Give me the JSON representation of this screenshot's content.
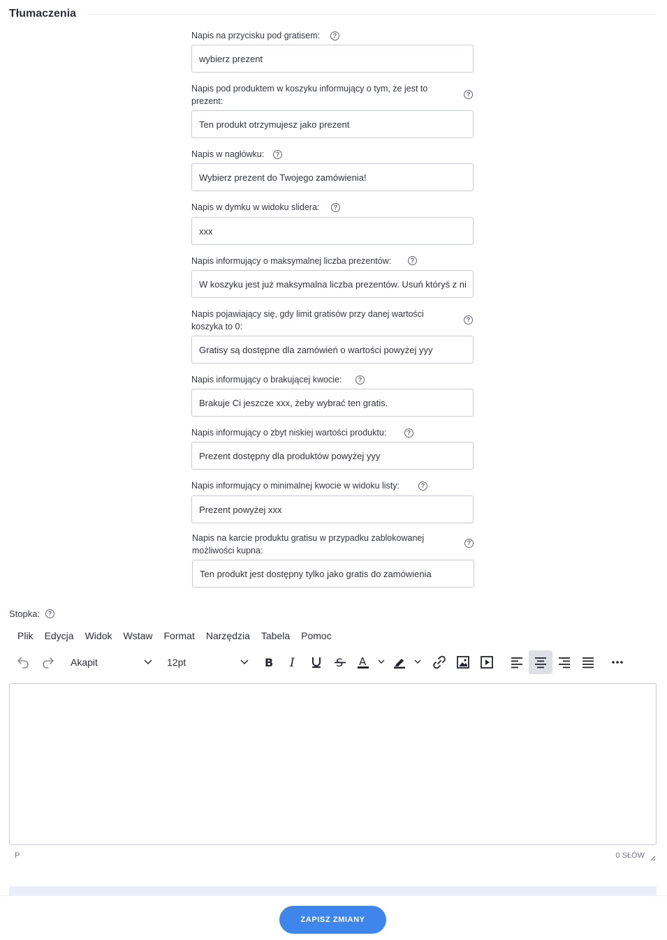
{
  "section": {
    "title": "Tłumaczenia"
  },
  "fields": [
    {
      "label": "Napis na przycisku pod gratisem:",
      "value": "wybierz prezent"
    },
    {
      "label": "Napis pod produktem w koszyku informujący o tym, że jest to prezent:",
      "value": "Ten produkt otrzymujesz jako prezent"
    },
    {
      "label": "Napis w nagłówku:",
      "value": "Wybierz prezent do Twojego zamówienia!"
    },
    {
      "label": "Napis w dymku w widoku slidera:",
      "value": "xxx"
    },
    {
      "label": "Napis informujący o maksymalnej liczba prezentów:",
      "value": "W koszyku jest już maksymalna liczba prezentów. Usuń któryś z nich"
    },
    {
      "label": "Napis pojawiający się, gdy limit gratisów przy danej wartości koszyka to 0:",
      "value": "Gratisy są dostępne dla zamówień o wartości powyżej yyy"
    },
    {
      "label": "Napis informujący o brakującej kwocie:",
      "value": "Brakuje Ci jeszcze xxx, żeby wybrać ten gratis."
    },
    {
      "label": "Napis informujący o zbyt niskiej wartości produktu:",
      "value": "Prezent dostępny dla produktów powyżej yyy"
    },
    {
      "label": "Napis informujący o minimalnej kwocie w widoku listy:",
      "value": "Prezent powyżej xxx"
    },
    {
      "label": "Napis na karcie produktu gratisu w przypadku zablokowanej możliwości kupna:",
      "value": "Ten produkt jest dostępny tylko jako gratis do zamówienia"
    }
  ],
  "editor": {
    "label": "Stopka:",
    "menu": [
      "Plik",
      "Edycja",
      "Widok",
      "Wstaw",
      "Format",
      "Narzędzia",
      "Tabela",
      "Pomoc"
    ],
    "block_format": "Akapit",
    "font_size": "12pt",
    "toolbar_icons": [
      "undo-icon",
      "redo-icon",
      "bold-icon",
      "italic-icon",
      "underline-icon",
      "strikethrough-icon",
      "text-color-icon",
      "highlight-color-icon",
      "link-icon",
      "image-icon",
      "media-icon",
      "align-left-icon",
      "align-center-icon",
      "align-right-icon",
      "align-justify-icon",
      "more-icon"
    ],
    "active_tool": "align-center-icon",
    "status_path": "P",
    "word_count": "0 SŁÓW"
  },
  "footer": {
    "save_label": "ZAPISZ ZMIANY"
  },
  "colors": {
    "accent": "#3e86ec",
    "border": "#c8cbd3",
    "text": "#303441"
  }
}
